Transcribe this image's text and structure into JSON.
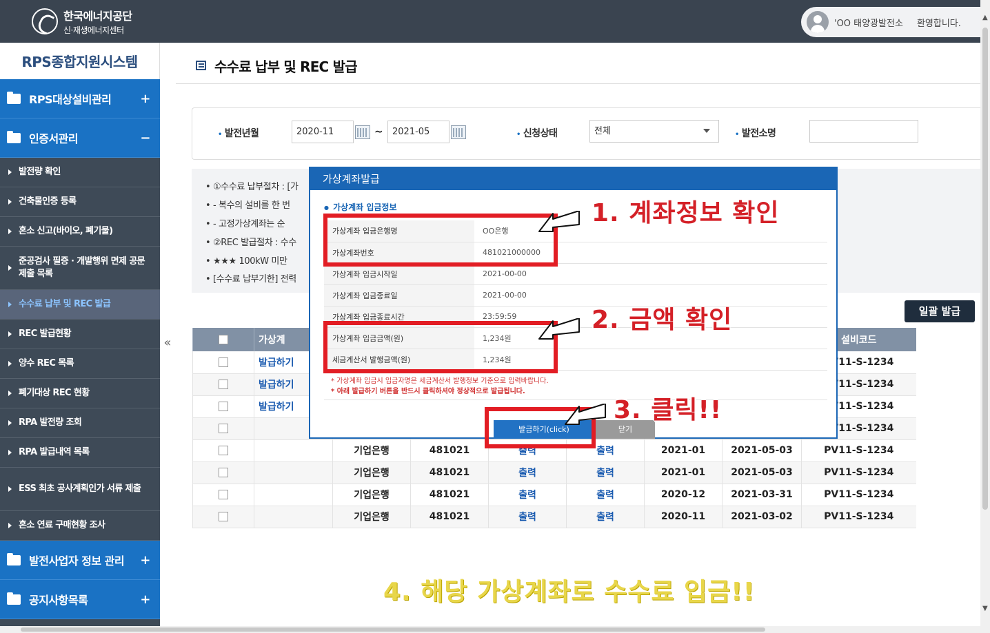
{
  "header": {
    "org_name": "한국에너지공단",
    "org_sub": "신·재생에너지센터",
    "user_plant": "'OO 태양광발전소",
    "welcome": "환영합니다."
  },
  "sidebar": {
    "system_title": "RPS종합지원시스템",
    "sections": [
      {
        "label": "RPS대상설비관리",
        "toggle": "+"
      },
      {
        "label": "인증서관리",
        "toggle": "−"
      }
    ],
    "sub_items": [
      "발전량 확인",
      "건축물인증 등록",
      "혼소 신고(바이오, 폐기물)",
      "준공검사 필증 · 개발행위 면제 공문 제출 목록",
      "수수료 납부 및 REC 발급",
      "REC 발급현황",
      "양수 REC 목록",
      "폐기대상 REC 현황",
      "RPA 발전량 조회",
      "RPA 발급내역 목록",
      "ESS 최초 공사계획인가 서류 제출",
      "혼소 연료 구매현황 조사"
    ],
    "bottom_sections": [
      {
        "label": "발전사업자 정보 관리",
        "toggle": "+"
      },
      {
        "label": "공지사항목록",
        "toggle": "+"
      }
    ],
    "collapse_glyph": "«"
  },
  "page": {
    "title": "수수료 납부 및 REC 발급"
  },
  "search": {
    "period_label": "발전년월",
    "from": "2020-11",
    "tilde": "~",
    "to": "2021-05",
    "status_label": "신청상태",
    "status_value": "전체",
    "plant_label": "발전소명",
    "plant_value": ""
  },
  "notice": [
    "• ①수수료 납부절차 : [가",
    "•    - 복수의 설비를 한 번",
    "•    - 고정가상계좌는 순",
    "• ②REC 발급절차 : 수수",
    "•      ★★★ 100kW 미만",
    "• [수수료 납부기한] 전력"
  ],
  "bulk_button": "일괄 발급",
  "table": {
    "headers": [
      "",
      "가상계",
      "",
      "",
      "",
      "",
      "",
      "",
      "설비코드"
    ],
    "rows": [
      [
        "",
        "발급하기",
        "",
        "",
        "",
        "",
        "",
        "",
        "PV11-S-1234"
      ],
      [
        "",
        "발급하기",
        "",
        "",
        "",
        "",
        "",
        "",
        "PV11-S-1234"
      ],
      [
        "",
        "발급하기",
        "",
        "",
        "",
        "",
        "",
        "",
        "PV11-S-1234"
      ],
      [
        "",
        "",
        "",
        "",
        "",
        "",
        "",
        "",
        "PV11-S-1234"
      ],
      [
        "",
        "",
        "기업은행",
        "481021",
        "출력",
        "출력",
        "2021-01",
        "2021-05-03",
        "PV11-S-1234"
      ],
      [
        "",
        "",
        "기업은행",
        "481021",
        "출력",
        "출력",
        "2021-01",
        "2021-05-03",
        "PV11-S-1234"
      ],
      [
        "",
        "",
        "기업은행",
        "481021",
        "출력",
        "출력",
        "2020-12",
        "2021-03-31",
        "PV11-S-1234"
      ],
      [
        "",
        "",
        "기업은행",
        "481021",
        "출력",
        "출력",
        "2020-11",
        "2021-03-02",
        "PV11-S-1234"
      ]
    ]
  },
  "modal": {
    "title": "가상계좌발급",
    "section": "가상계좌 입금정보",
    "rows": [
      {
        "key": "가상계좌 입금은행명",
        "value": "OO은행"
      },
      {
        "key": "가상계좌번호",
        "value": "481021000000"
      },
      {
        "key": "가상계좌 입금시작일",
        "value": "2021-00-00"
      },
      {
        "key": "가상계좌 입금종료일",
        "value": "2021-00-00"
      },
      {
        "key": "가상계좌 입금종료시간",
        "value": "23:59:59"
      },
      {
        "key": "가상계좌 입금금액(원)",
        "value": "1,234원"
      },
      {
        "key": "세금계산서 발행금액(원)",
        "value": "1,234원"
      }
    ],
    "note1": "* 가상계좌 입금시 입금자명은 세금계산서 발행정보 기준으로 입력바랍니다.",
    "note2": "* 아래 발급하기 버튼을 반드시 클릭하셔야 정상적으로 발급됩니다.",
    "issue_button": "발급하기(click)",
    "close_button": "닫기"
  },
  "annotations": {
    "step1": "1. 계좌정보 확인",
    "step2": "2. 금액 확인",
    "step3": "3. 클릭!!",
    "step4": "4. 해당 가상계좌로 수수료 입금!!"
  }
}
